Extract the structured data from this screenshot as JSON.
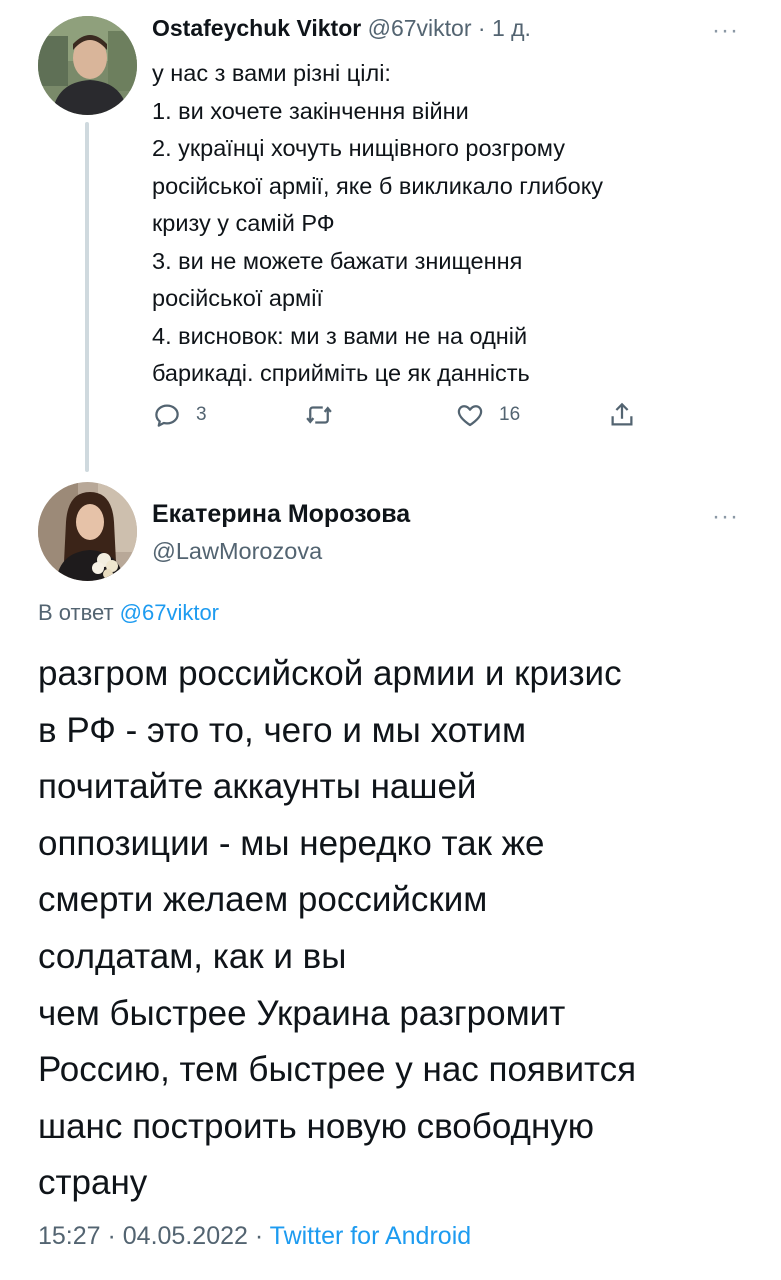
{
  "tweet1": {
    "display_name": "Ostafeychuk Viktor",
    "handle": "@67viktor",
    "separator": "·",
    "time": "1 д.",
    "more": "···",
    "lines": [
      "у нас з вами різні цілі:",
      "1. ви хочете закінчення війни",
      "2. українці хочуть нищівного розгрому",
      "російської армії, яке б викликало глибоку",
      "кризу у самій РФ",
      "3. ви не можете бажати знищення",
      "російської армії",
      "4. висновок: ми з вами не на одній",
      "барикаді. сприйміть це як данність"
    ],
    "reply_count": "3",
    "like_count": "16"
  },
  "tweet2": {
    "display_name": "Екатерина Морозова",
    "handle": "@LawMorozova",
    "more": "···",
    "reply_prefix": "В ответ",
    "reply_handle": "@67viktor",
    "lines": [
      "разгром российской армии и кризис",
      "в РФ - это то, чего и мы хотим",
      "почитайте аккаунты нашей",
      "оппозиции - мы нередко так же",
      "смерти желаем российским",
      "солдатам, как и вы",
      "чем быстрее Украина разгромит",
      "Россию, тем быстрее у нас появится",
      "шанс построить новую свободную",
      "страну"
    ],
    "timestamp": "15:27 · 04.05.2022 · ",
    "source": "Twitter for Android"
  },
  "colors": {
    "link": "#1d9bf0",
    "muted": "#536471",
    "thread_line": "#cfd9de"
  }
}
